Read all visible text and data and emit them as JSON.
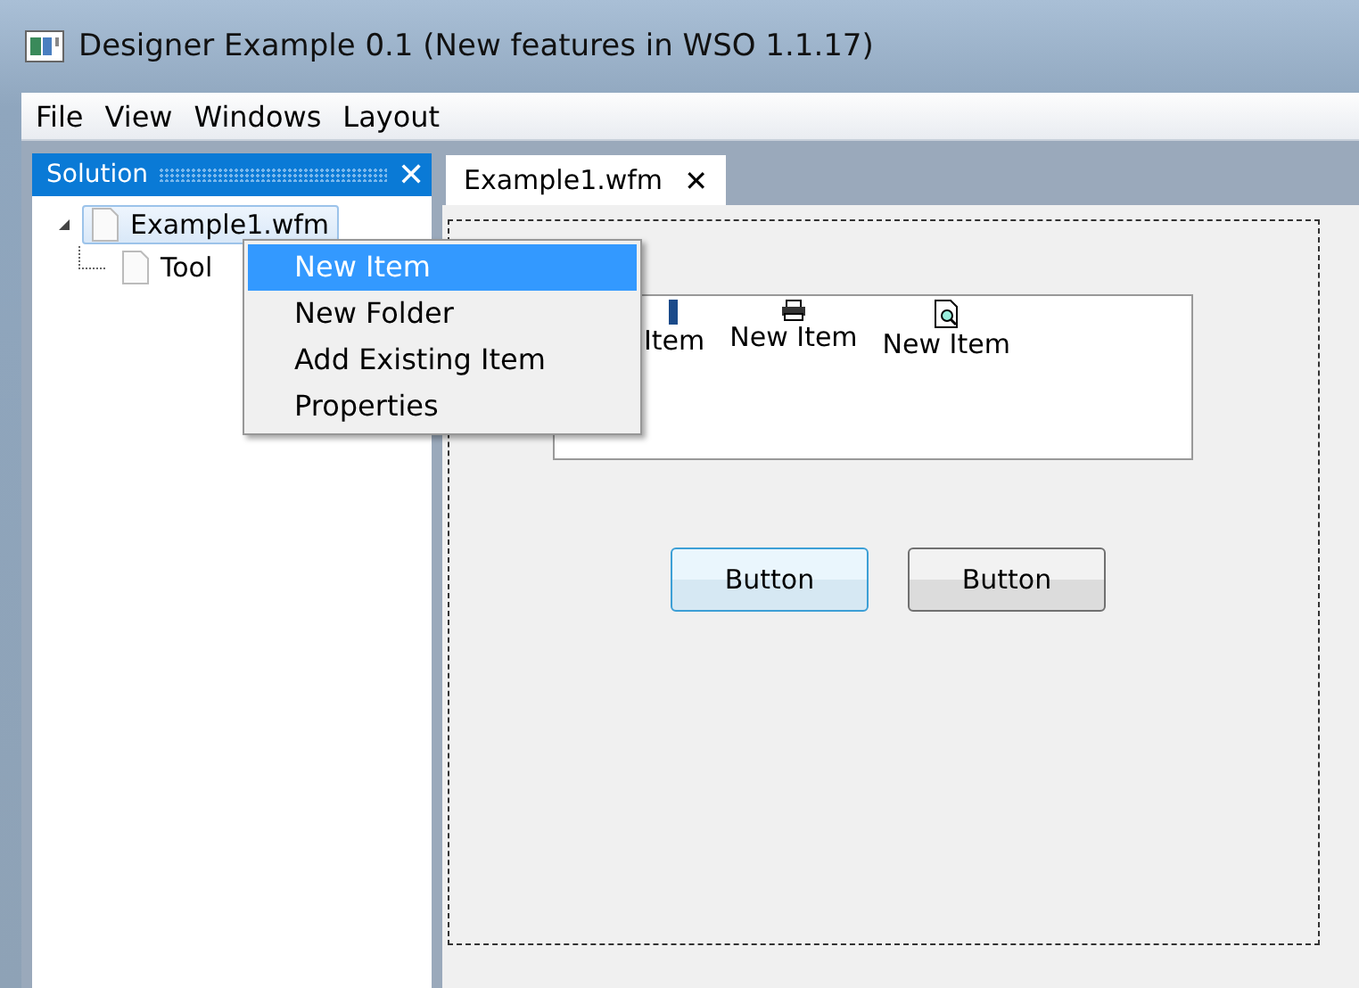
{
  "window": {
    "title": "Designer Example 0.1 (New features in WSO 1.1.17)"
  },
  "menu_bar": [
    "File",
    "View",
    "Windows",
    "Layout"
  ],
  "solution_panel": {
    "title": "Solution",
    "close": "✕",
    "tree": [
      {
        "label": "Example1.wfm",
        "selected": true,
        "expanded": true,
        "children": [
          {
            "label": "Tool",
            "selected": false
          }
        ]
      }
    ]
  },
  "context_menu": [
    {
      "label": "New Item",
      "selected": true
    },
    {
      "label": "New Folder",
      "selected": false
    },
    {
      "label": "Add Existing Item",
      "selected": false
    },
    {
      "label": "Properties",
      "selected": false
    }
  ],
  "document_tabs": [
    {
      "label": "Example1.wfm",
      "close": "✕",
      "selected": true
    }
  ],
  "designer": {
    "toolbar_items": [
      {
        "label": "Item",
        "kind": "partial"
      },
      {
        "label": "New Item",
        "kind": "printer"
      },
      {
        "label": "New Item",
        "kind": "preview"
      }
    ],
    "buttons": [
      {
        "label": "Button",
        "focused": true
      },
      {
        "label": "Button",
        "focused": false
      }
    ]
  }
}
